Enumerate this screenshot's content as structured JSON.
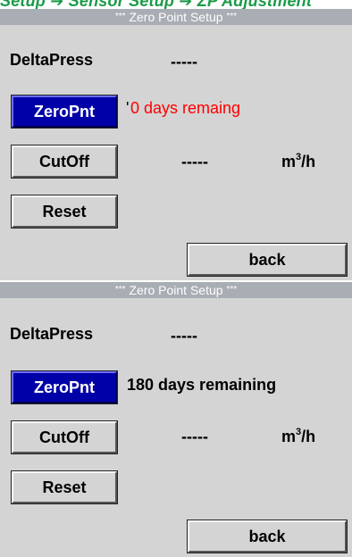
{
  "breadcrumb": "Setup  ➔  Sensor Setup  ➔  ZP Adjustment",
  "screens": [
    {
      "title": "Zero Point Setup",
      "title_stars": "***",
      "sensor_label": "DeltaPress",
      "sensor_value": "-----",
      "zeropnt_label": "ZeroPnt",
      "zeropnt_status": "0 days remaing",
      "zeropnt_status_color": "#ff0000",
      "zeropnt_status_prefix": "'",
      "cutoff_label": "CutOff",
      "cutoff_value": "-----",
      "cutoff_unit": "m",
      "cutoff_unit_sup": "3",
      "cutoff_unit_suffix": "/h",
      "reset_label": "Reset",
      "back_label": "back"
    },
    {
      "title": "Zero Point Setup",
      "title_stars": "***",
      "sensor_label": "DeltaPress",
      "sensor_value": "-----",
      "zeropnt_label": "ZeroPnt",
      "zeropnt_status": "180 days remaining",
      "zeropnt_status_color": "#000000",
      "cutoff_label": "CutOff",
      "cutoff_value": "-----",
      "cutoff_unit": "m",
      "cutoff_unit_sup": "3",
      "cutoff_unit_suffix": "/h",
      "reset_label": "Reset",
      "back_label": "back"
    }
  ],
  "colors": {
    "panel_bg": "#d4d4d4",
    "titlebar_bg": "#a9adb4",
    "active_button_bg": "#0000a8",
    "breadcrumb_text": "#1a9b47"
  }
}
